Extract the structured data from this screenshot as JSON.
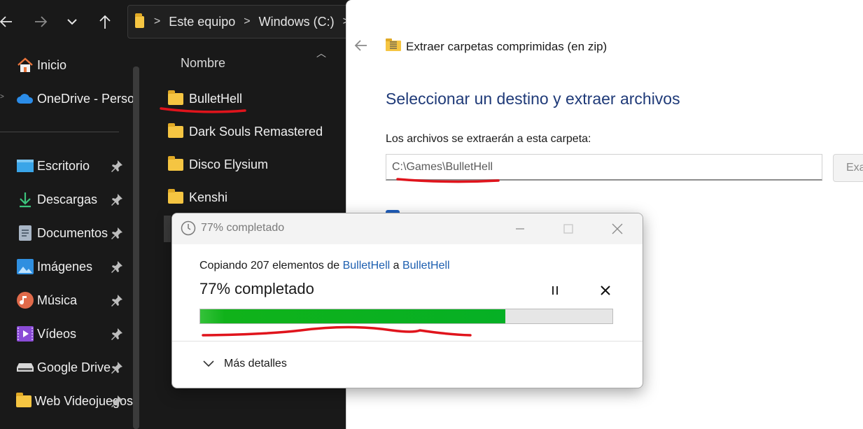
{
  "explorer": {
    "address": {
      "segments": [
        "Este equipo",
        "Windows (C:)"
      ]
    },
    "sidebar": {
      "items": [
        {
          "label": "Inicio",
          "icon": "home-icon"
        },
        {
          "label": "OneDrive - Perso",
          "icon": "onedrive-icon"
        },
        {
          "label": "Escritorio",
          "icon": "desktop-icon",
          "pinned": true
        },
        {
          "label": "Descargas",
          "icon": "download-icon",
          "pinned": true
        },
        {
          "label": "Documentos",
          "icon": "documents-icon",
          "pinned": true
        },
        {
          "label": "Imágenes",
          "icon": "pictures-icon",
          "pinned": true
        },
        {
          "label": "Música",
          "icon": "music-icon",
          "pinned": true
        },
        {
          "label": "Vídeos",
          "icon": "videos-icon",
          "pinned": true
        },
        {
          "label": "Google Drive",
          "icon": "drive-icon",
          "pinned": true
        },
        {
          "label": "Web Videojuegos",
          "icon": "folder-icon",
          "pinned": true
        }
      ]
    },
    "column_header": "Nombre",
    "files": [
      "BulletHell",
      "Dark Souls Remastered",
      "Disco Elysium",
      "Kenshi"
    ]
  },
  "wizard": {
    "title": "Extraer carpetas comprimidas (en zip)",
    "heading": "Seleccionar un destino y extraer archivos",
    "label": "Los archivos se extraerán a esta carpeta:",
    "destination": "C:\\Games\\BulletHell",
    "browse_label": "Exa"
  },
  "dialog": {
    "title": "77% completado",
    "copying_prefix": "Copiando 207 elementos de ",
    "source": "BulletHell",
    "connector": " a ",
    "target": "BulletHell",
    "percent_text": "77% completado",
    "progress": 0.74,
    "details_label": "Más detalles"
  },
  "colors": {
    "progress_green": "#06b025",
    "link_blue": "#1d5fb0",
    "heading_blue": "#1f3a78",
    "annotation_red": "#e0141c"
  }
}
